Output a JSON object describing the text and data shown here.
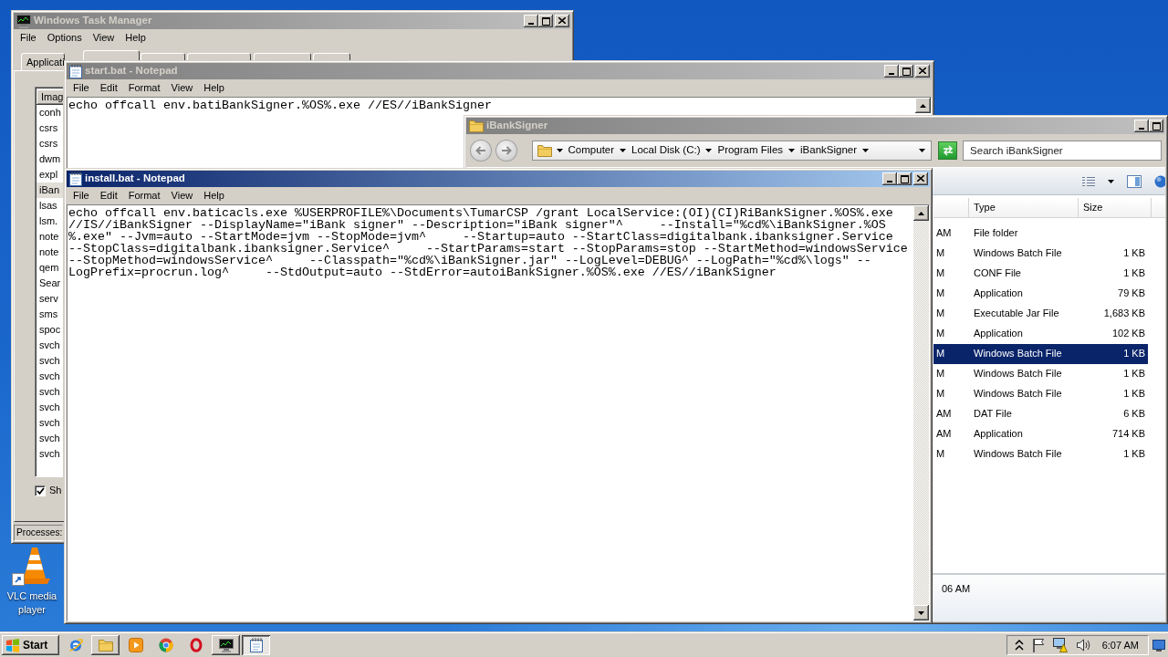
{
  "desktop": {
    "icons": [
      {
        "label": "VLC media player"
      }
    ]
  },
  "task_manager": {
    "title": "Windows Task Manager",
    "active": false,
    "menu": [
      "File",
      "Options",
      "View",
      "Help"
    ],
    "tabs": [
      {
        "label": "Applicati",
        "selected": false
      },
      {
        "selected": true
      },
      {
        "selected": false
      },
      {
        "selected": false
      },
      {
        "selected": false
      },
      {
        "selected": false
      }
    ],
    "columns": [
      "Imag"
    ],
    "processes": [
      {
        "name": "conh",
        "selected": false
      },
      {
        "name": "csrs",
        "selected": false
      },
      {
        "name": "csrs",
        "selected": false
      },
      {
        "name": "dwm",
        "selected": false
      },
      {
        "name": "expl",
        "selected": false
      },
      {
        "name": "iBan",
        "selected": true
      },
      {
        "name": "lsas",
        "selected": false
      },
      {
        "name": "lsm.",
        "selected": false
      },
      {
        "name": "note",
        "selected": false
      },
      {
        "name": "note",
        "selected": false
      },
      {
        "name": "qem",
        "selected": false
      },
      {
        "name": "Sear",
        "selected": false
      },
      {
        "name": "serv",
        "selected": false
      },
      {
        "name": "sms",
        "selected": false
      },
      {
        "name": "spoc",
        "selected": false
      },
      {
        "name": "svch",
        "selected": false
      },
      {
        "name": "svch",
        "selected": false
      },
      {
        "name": "svch",
        "selected": false
      },
      {
        "name": "svch",
        "selected": false
      },
      {
        "name": "svch",
        "selected": false
      },
      {
        "name": "svch",
        "selected": false
      },
      {
        "name": "svch",
        "selected": false
      },
      {
        "name": "svch",
        "selected": false
      }
    ],
    "show_all": {
      "label": "Sh",
      "checked": true
    },
    "status_bar": "Processes:"
  },
  "start_notepad": {
    "title": "start.bat - Notepad",
    "active": false,
    "menu": [
      "File",
      "Edit",
      "Format",
      "View",
      "Help"
    ],
    "lines": [
      "echo offcall env.batiBankSigner.%OS%.exe //ES//iBankSigner"
    ]
  },
  "explorer": {
    "title": "iBankSigner",
    "active": false,
    "address": [
      "Computer",
      "Local Disk (C:)",
      "Program Files",
      "iBankSigner"
    ],
    "search": {
      "placeholder": "Search iBankSigner"
    },
    "columns": [
      "Type",
      "Size"
    ],
    "rows": [
      {
        "column_1": "AM",
        "type": "File folder",
        "selected": false
      },
      {
        "column_1": "M",
        "type": "Windows Batch File",
        "size": "1 KB",
        "selected": false
      },
      {
        "column_1": "M",
        "type": "CONF File",
        "size": "1 KB",
        "selected": false
      },
      {
        "column_1": "M",
        "type": "Application",
        "size": "79 KB",
        "selected": false
      },
      {
        "column_1": "M",
        "type": "Executable Jar File",
        "size": "1,683 KB",
        "selected": false
      },
      {
        "column_1": "M",
        "type": "Application",
        "size": "102 KB",
        "selected": false
      },
      {
        "column_1": "M",
        "type": "Windows Batch File",
        "size": "1 KB",
        "selected": true
      },
      {
        "column_1": "M",
        "type": "Windows Batch File",
        "size": "1 KB",
        "selected": false
      },
      {
        "column_1": "M",
        "type": "Windows Batch File",
        "size": "1 KB",
        "selected": false
      },
      {
        "column_1": "AM",
        "type": "DAT File",
        "size": "6 KB",
        "selected": false
      },
      {
        "column_1": "AM",
        "type": "Application",
        "size": "714 KB",
        "selected": false
      },
      {
        "column_1": "M",
        "type": "Windows Batch File",
        "size": "1 KB",
        "selected": false
      }
    ],
    "details": "06 AM"
  },
  "install_notepad": {
    "title": "install.bat - Notepad",
    "active": true,
    "menu": [
      "File",
      "Edit",
      "Format",
      "View",
      "Help"
    ],
    "lines": [
      "echo offcall env.baticacls.exe %USERPROFILE%\\Documents\\TumarCSP /grant LocalService:(OI)(CI)RiBankSigner.%OS%.exe",
      "//IS//iBankSigner --DisplayName=\"iBank signer\" --Description=\"iBank signer\"^     --Install=\"%cd%\\iBankSigner.%OS",
      "%.exe\" --Jvm=auto --StartMode=jvm --StopMode=jvm^     --Startup=auto --StartClass=digitalbank.ibanksigner.Service",
      "--StopClass=digitalbank.ibanksigner.Service^     --StartParams=start --StopParams=stop --StartMethod=windowsService",
      "--StopMethod=windowsService^     --Classpath=\"%cd%\\iBankSigner.jar\" --LogLevel=DEBUG^ --LogPath=\"%cd%\\logs\" --",
      "LogPrefix=procrun.log^     --StdOutput=auto --StdError=autoiBankSigner.%OS%.exe //ES//iBankSigner"
    ]
  },
  "taskbar": {
    "start": "Start",
    "apps": [
      {
        "kind": "ie",
        "running": false,
        "selected": false
      },
      {
        "kind": "explorer",
        "running": true,
        "selected": false
      },
      {
        "kind": "media_player",
        "running": false,
        "selected": false
      },
      {
        "kind": "chrome",
        "running": false,
        "selected": false
      },
      {
        "kind": "opera",
        "running": false,
        "selected": false
      },
      {
        "kind": "task_manager",
        "running": true,
        "selected": false
      },
      {
        "kind": "notepad",
        "running": true,
        "selected": true
      }
    ],
    "clock": "6:07 AM"
  }
}
